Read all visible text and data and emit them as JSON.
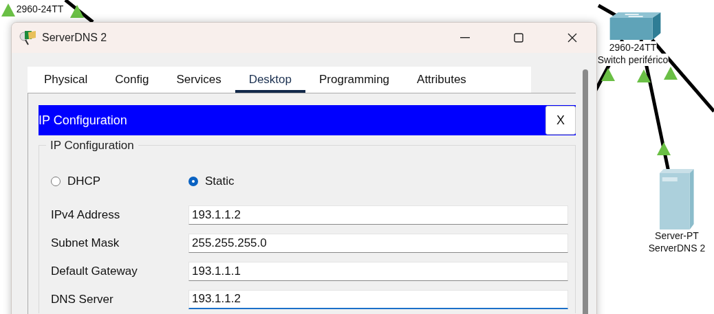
{
  "canvas": {
    "devices": [
      {
        "kind": "label",
        "lines": [
          "2960-24TT"
        ]
      },
      {
        "kind": "switch",
        "lines": [
          "2960-24TT",
          "Switch periférico"
        ]
      },
      {
        "kind": "server",
        "lines": [
          "Server-PT",
          "ServerDNS 2"
        ]
      }
    ]
  },
  "window": {
    "title": "ServerDNS 2",
    "tabs": [
      {
        "label": "Physical",
        "selected": false
      },
      {
        "label": "Config",
        "selected": false
      },
      {
        "label": "Services",
        "selected": false
      },
      {
        "label": "Desktop",
        "selected": true
      },
      {
        "label": "Programming",
        "selected": false
      },
      {
        "label": "Attributes",
        "selected": false
      }
    ],
    "app": {
      "title": "IP Configuration",
      "close": "X",
      "group_title": "IP Configuration",
      "modes": [
        {
          "label": "DHCP",
          "selected": false
        },
        {
          "label": "Static",
          "selected": true
        }
      ],
      "fields": [
        {
          "label": "IPv4 Address",
          "value": "193.1.1.2",
          "focused": false
        },
        {
          "label": "Subnet Mask",
          "value": "255.255.255.0",
          "focused": false
        },
        {
          "label": "Default Gateway",
          "value": "193.1.1.1",
          "focused": false
        },
        {
          "label": "DNS Server",
          "value": "193.1.1.2",
          "focused": true
        }
      ]
    }
  }
}
